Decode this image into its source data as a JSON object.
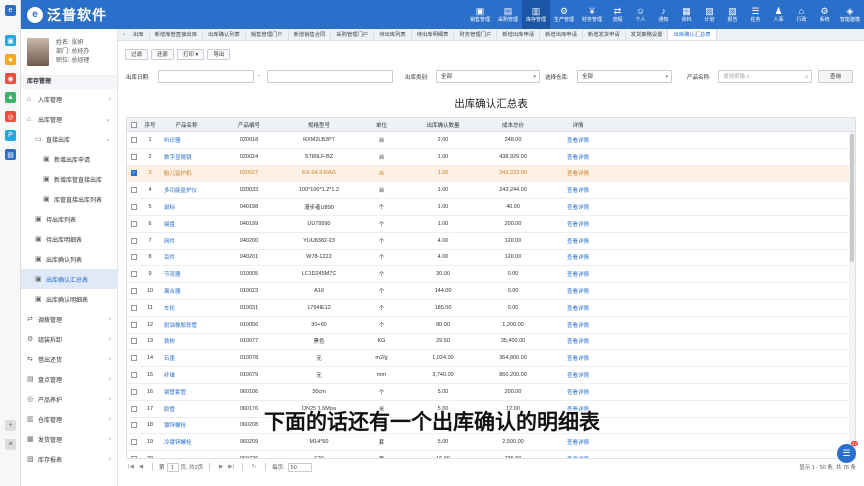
{
  "app": {
    "name": "泛普软件",
    "logo_glyph": "e",
    "rail_label": "泛普软件"
  },
  "modules": [
    {
      "label": "销售管理",
      "icon": "▣",
      "active": false
    },
    {
      "label": "采购管理",
      "icon": "▤",
      "active": false
    },
    {
      "label": "库存管理",
      "icon": "▥",
      "active": true
    },
    {
      "label": "生产管理",
      "icon": "⚙",
      "active": false
    },
    {
      "label": "财务管理",
      "icon": "¥",
      "active": false
    },
    {
      "label": "流程",
      "icon": "⇄",
      "active": false
    },
    {
      "label": "个人",
      "icon": "☺",
      "active": false
    },
    {
      "label": "通知",
      "icon": "♪",
      "active": false
    },
    {
      "label": "资料",
      "icon": "▦",
      "active": false
    },
    {
      "label": "计划",
      "icon": "▧",
      "active": false
    },
    {
      "label": "报告",
      "icon": "▨",
      "active": false
    },
    {
      "label": "任务",
      "icon": "☰",
      "active": false
    },
    {
      "label": "人事",
      "icon": "♟",
      "active": false
    },
    {
      "label": "行政",
      "icon": "⌂",
      "active": false
    },
    {
      "label": "系统",
      "icon": "⚙",
      "active": false
    },
    {
      "label": "智能建模",
      "icon": "◈",
      "active": false
    }
  ],
  "user": {
    "name": "姓名: 张妍",
    "dept": "部门: 总经办",
    "position": "职位: 总经理"
  },
  "sidebar": {
    "section": "库存管理",
    "items": [
      {
        "label": "入库管理",
        "icon": "⌂",
        "level": 1,
        "chevron": "›",
        "active": false
      },
      {
        "label": "出库管理",
        "icon": "⌂",
        "level": 1,
        "chevron": "⌄",
        "active": false
      },
      {
        "label": "直接出库",
        "icon": "▭",
        "level": 2,
        "chevron": "⌄",
        "active": false
      },
      {
        "label": "新增出库申请",
        "icon": "▣",
        "level": 3,
        "chevron": "",
        "active": false
      },
      {
        "label": "新增库管直接出库",
        "icon": "▣",
        "level": 3,
        "chevron": "",
        "active": false
      },
      {
        "label": "库管直接出库列表",
        "icon": "▣",
        "level": 3,
        "chevron": "",
        "active": false
      },
      {
        "label": "待出库列表",
        "icon": "▣",
        "level": 2,
        "chevron": "",
        "active": false
      },
      {
        "label": "待出库明细表",
        "icon": "▣",
        "level": 2,
        "chevron": "",
        "active": false
      },
      {
        "label": "出库确认列表",
        "icon": "▣",
        "level": 2,
        "chevron": "",
        "active": false
      },
      {
        "label": "出库确认汇总表",
        "icon": "▣",
        "level": 2,
        "chevron": "",
        "active": true
      },
      {
        "label": "出库确认明细表",
        "icon": "▣",
        "level": 2,
        "chevron": "",
        "active": false
      },
      {
        "label": "调拨管理",
        "icon": "⇄",
        "level": 1,
        "chevron": "›",
        "active": false
      },
      {
        "label": "组装拆卸",
        "icon": "⚙",
        "level": 1,
        "chevron": "›",
        "active": false
      },
      {
        "label": "借出还货",
        "icon": "⇆",
        "level": 1,
        "chevron": "›",
        "active": false
      },
      {
        "label": "盘点管理",
        "icon": "▤",
        "level": 1,
        "chevron": "›",
        "active": false
      },
      {
        "label": "产品养护",
        "icon": "◎",
        "level": 1,
        "chevron": "›",
        "active": false
      },
      {
        "label": "仓库管理",
        "icon": "▥",
        "level": 1,
        "chevron": "›",
        "active": false
      },
      {
        "label": "发货管理",
        "icon": "▦",
        "level": 1,
        "chevron": "›",
        "active": false
      },
      {
        "label": "库存报表",
        "icon": "▧",
        "level": 1,
        "chevron": "›",
        "active": false
      }
    ]
  },
  "tabs": [
    {
      "label": "出库",
      "active": false
    },
    {
      "label": "新增库管直接出库",
      "active": false
    },
    {
      "label": "出库确认列表",
      "active": false
    },
    {
      "label": "销售管理门户",
      "active": false
    },
    {
      "label": "新增销售合同",
      "active": false
    },
    {
      "label": "采购管理门户",
      "active": false
    },
    {
      "label": "待出库列表",
      "active": false
    },
    {
      "label": "待出库明细表",
      "active": false
    },
    {
      "label": "财务管理门户",
      "active": false
    },
    {
      "label": "新增出库申请",
      "active": false
    },
    {
      "label": "新增出库申请",
      "active": false
    },
    {
      "label": "新增发货申请",
      "active": false
    },
    {
      "label": "发货策略设置",
      "active": false
    },
    {
      "label": "出库确认汇总表",
      "active": true
    }
  ],
  "toolbar": {
    "filter": "过滤",
    "restore": "还原",
    "print": "打印 ▾",
    "export": "导出"
  },
  "filters": {
    "date_label": "出库日期:",
    "date_sep": "-",
    "type_label": "出库类别:",
    "type_value": "全部",
    "warehouse_label": "选择仓库:",
    "warehouse_value": "全部",
    "product_label": "产品名称:",
    "product_placeholder": "请搜索输入",
    "query_button": "查询"
  },
  "report_title": "出库确认汇总表",
  "table": {
    "headers": [
      "序号",
      "产品名称",
      "产品编号",
      "规格型号",
      "单位",
      "出库确认数量",
      "成本总价",
      "详情"
    ],
    "link_label": "查看详情",
    "rows": [
      {
        "n": "1",
        "name": "听诊器",
        "code": "020018",
        "spec": "RXM2LB2P7",
        "unit": "台",
        "qty": "2.00",
        "cost": "248.00",
        "sel": false
      },
      {
        "n": "2",
        "name": "数字显微镜",
        "code": "020024",
        "spec": "ST80LF-BZ",
        "unit": "台",
        "qty": "1.00",
        "cost": "438,929.00",
        "sel": false
      },
      {
        "n": "3",
        "name": "胎儿监护机",
        "code": "020027",
        "spec": "EX-24-3-RAG",
        "unit": "台",
        "qty": "1.00",
        "cost": "242,223.00",
        "sel": true
      },
      {
        "n": "4",
        "name": "多功能监护仪",
        "code": "020033",
        "spec": "100*100*1.2*1.2",
        "unit": "台",
        "qty": "1.00",
        "cost": "243,244.00",
        "sel": false
      },
      {
        "n": "5",
        "name": "鼠标",
        "code": "040198",
        "spec": "漫步者U890",
        "unit": "个",
        "qty": "1.00",
        "cost": "40.00",
        "sel": false
      },
      {
        "n": "6",
        "name": "键盘",
        "code": "040199",
        "spec": "UU79990",
        "unit": "个",
        "qty": "1.00",
        "cost": "200.00",
        "sel": false
      },
      {
        "n": "7",
        "name": "网件",
        "code": "040200",
        "spec": "YUU8382-23",
        "unit": "个",
        "qty": "4.00",
        "cost": "120.00",
        "sel": false
      },
      {
        "n": "8",
        "name": "耳件",
        "code": "040201",
        "spec": "W78-1222",
        "unit": "个",
        "qty": "4.00",
        "cost": "120.00",
        "sel": false
      },
      {
        "n": "9",
        "name": "节流器",
        "code": "010005",
        "spec": "LC1D245M7C",
        "unit": "个",
        "qty": "30.00",
        "cost": "0.00",
        "sel": false
      },
      {
        "n": "10",
        "name": "离合器",
        "code": "010023",
        "spec": "A16",
        "unit": "个",
        "qty": "144.00",
        "cost": "0.00",
        "sel": false
      },
      {
        "n": "11",
        "name": "车轮",
        "code": "010031",
        "spec": "1794IE12",
        "unit": "个",
        "qty": "185.00",
        "cost": "0.00",
        "sel": false
      },
      {
        "n": "12",
        "name": "耐油橡胶软管",
        "code": "010056",
        "spec": "30+60",
        "unit": "个",
        "qty": "80.00",
        "cost": "1,200.00",
        "sel": false
      },
      {
        "n": "13",
        "name": "铁粉",
        "code": "010077",
        "spec": "黑色",
        "unit": "KG",
        "qty": "29.50",
        "cost": "35,400.00",
        "sel": false
      },
      {
        "n": "14",
        "name": "石墨",
        "code": "010078",
        "spec": "无",
        "unit": "m2/g",
        "qty": "1,024.00",
        "cost": "364,800.00",
        "sel": false
      },
      {
        "n": "15",
        "name": "纤维",
        "code": "010079",
        "spec": "无",
        "unit": "mm",
        "qty": "3,740.00",
        "cost": "860,200.00",
        "sel": false
      },
      {
        "n": "16",
        "name": "钢管套管",
        "code": "060106",
        "spec": "30cm",
        "unit": "个",
        "qty": "5.00",
        "cost": "200.00",
        "sel": false
      },
      {
        "n": "17",
        "name": "胶管",
        "code": "060176",
        "spec": "DN25 1.6Mpa",
        "unit": "米",
        "qty": "5.00",
        "cost": "12.00",
        "sel": false
      },
      {
        "n": "18",
        "name": "镀锌螺栓",
        "code": "060208",
        "spec": "",
        "unit": "",
        "qty": "",
        "cost": "",
        "sel": false
      },
      {
        "n": "19",
        "name": "冷镀锌螺栓",
        "code": "060209",
        "spec": "M14*60",
        "unit": "套",
        "qty": "5.00",
        "cost": "2,500.00",
        "sel": false
      },
      {
        "n": "20",
        "name": "",
        "code": "060226",
        "spec": "F20",
        "unit": "套",
        "qty": "16.00",
        "cost": "736.00",
        "sel": false
      }
    ]
  },
  "pager": {
    "first": "|◀",
    "prev": "◀",
    "page_prefix": "第",
    "page": "1",
    "page_suffix": "页, 共2页",
    "next": "▶",
    "last": "▶|",
    "refresh": "↻",
    "per_page_label": "每页:",
    "per_page": "50",
    "summary": "显示 1 - 50 条, 共 76 条"
  },
  "caption": "下面的话还有一个出库确认的明细表",
  "chat": {
    "badge": "22",
    "icon": "☰"
  },
  "colors": {
    "brand": "#2a6fc9",
    "selected_row": "#fdf1e3",
    "selected_text": "#c77d2a"
  }
}
